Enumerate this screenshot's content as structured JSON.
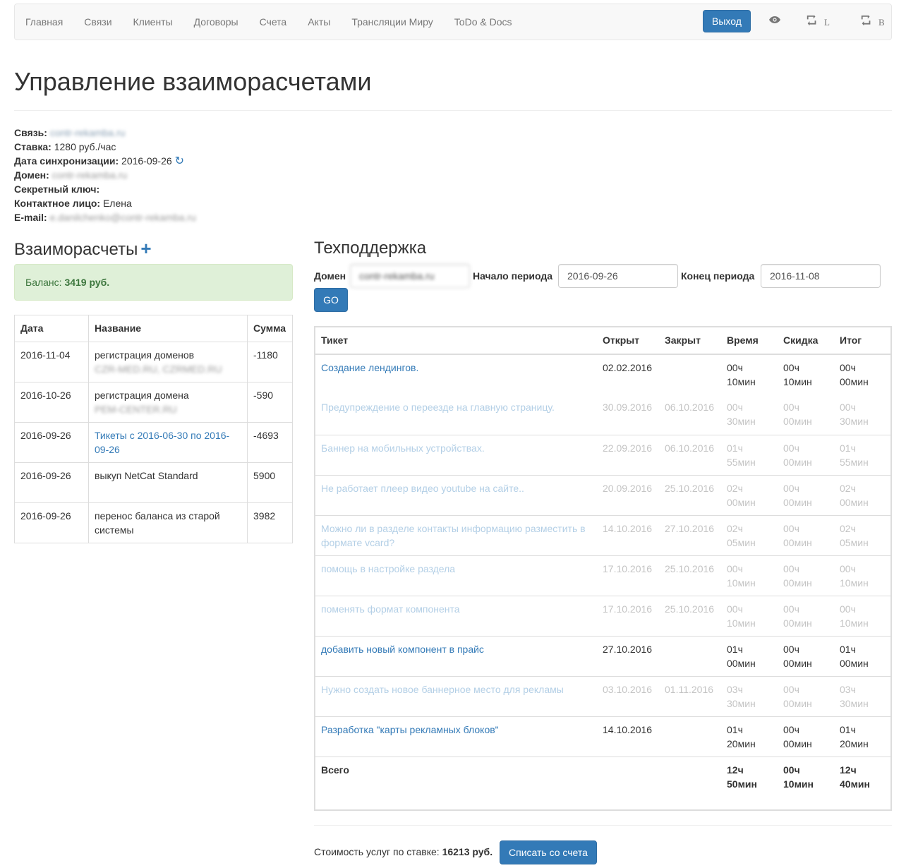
{
  "nav": {
    "items": [
      "Главная",
      "Связи",
      "Клиенты",
      "Договоры",
      "Счета",
      "Акты",
      "Трансляции Миру",
      "ToDo & Docs"
    ],
    "exit_label": "Выход",
    "eye_icon": "eye-icon",
    "retweet_l": "L",
    "retweet_b": "B"
  },
  "page": {
    "title": "Управление взаиморасчетами"
  },
  "info": {
    "link_label": "Связь:",
    "link_value": "contr-rekamba.ru",
    "rate_label": "Ставка:",
    "rate_value": "1280 руб./час",
    "sync_label": "Дата синхронизации:",
    "sync_value": "2016-09-26",
    "domain_label": "Домен:",
    "domain_value": "contr-rekamba.ru",
    "secret_label": "Секретный ключ:",
    "contact_label": "Контактное лицо:",
    "contact_value": "Елена",
    "email_label": "E-mail:",
    "email_value": "e.danilchenko@contr-rekamba.ru"
  },
  "settlements": {
    "title": "Взаиморасчеты",
    "balance_label": "Баланс:",
    "balance_value": "3419 руб.",
    "headers": [
      "Дата",
      "Название",
      "Сумма"
    ],
    "rows": [
      {
        "date": "2016-11-04",
        "name": "регистрация доменов",
        "sub": "CZR-MED.RU, CZRMED.RU",
        "sum": "-1180"
      },
      {
        "date": "2016-10-26",
        "name": "регистрация домена",
        "sub": "PEM-CENTER.RU",
        "sum": "-590"
      },
      {
        "date": "2016-09-26",
        "name": "Тикеты с 2016-06-30 по 2016-09-26",
        "sub": "",
        "sum": "-4693"
      },
      {
        "date": "2016-09-26",
        "name": "выкуп NetCat Standard",
        "sub": "",
        "sum": "5900"
      },
      {
        "date": "2016-09-26",
        "name": "перенос баланса из старой системы",
        "sub": "",
        "sum": "3982"
      }
    ]
  },
  "support": {
    "title": "Техподдержка",
    "domain_label": "Домен",
    "domain_value": "contr-rekamba.ru",
    "start_label": "Начало периода",
    "start_value": "2016-09-26",
    "end_label": "Конец периода",
    "end_value": "2016-11-08",
    "go_label": "GO",
    "headers": [
      "Тикет",
      "Открыт",
      "Закрыт",
      "Время",
      "Скидка",
      "Итог"
    ],
    "rows": [
      {
        "name": "Создание лендингов.",
        "opened": "02.02.2016",
        "closed": "",
        "time": [
          "00ч",
          "10мин"
        ],
        "discount": [
          "00ч",
          "10мин"
        ],
        "total": [
          "00ч",
          "00мин"
        ],
        "muted": false
      },
      {
        "name": "Предупреждение о переезде на главную страницу.",
        "opened": "30.09.2016",
        "closed": "06.10.2016",
        "time": [
          "00ч",
          "30мин"
        ],
        "discount": [
          "00ч",
          "00мин"
        ],
        "total": [
          "00ч",
          "30мин"
        ],
        "muted": true
      },
      {
        "name": "Баннер на мобильных устройствах.",
        "opened": "22.09.2016",
        "closed": "06.10.2016",
        "time": [
          "01ч",
          "55мин"
        ],
        "discount": [
          "00ч",
          "00мин"
        ],
        "total": [
          "01ч",
          "55мин"
        ],
        "muted": true
      },
      {
        "name": "Не работает плеер видео youtube на сайте..",
        "opened": "20.09.2016",
        "closed": "25.10.2016",
        "time": [
          "02ч",
          "00мин"
        ],
        "discount": [
          "00ч",
          "00мин"
        ],
        "total": [
          "02ч",
          "00мин"
        ],
        "muted": true
      },
      {
        "name": "Можно ли в разделе контакты информацию разместить в формате vcard?",
        "opened": "14.10.2016",
        "closed": "27.10.2016",
        "time": [
          "02ч",
          "05мин"
        ],
        "discount": [
          "00ч",
          "00мин"
        ],
        "total": [
          "02ч",
          "05мин"
        ],
        "muted": true
      },
      {
        "name": "помощь в настройке раздела",
        "opened": "17.10.2016",
        "closed": "25.10.2016",
        "time": [
          "00ч",
          "10мин"
        ],
        "discount": [
          "00ч",
          "00мин"
        ],
        "total": [
          "00ч",
          "10мин"
        ],
        "muted": true
      },
      {
        "name": "поменять формат компонента",
        "opened": "17.10.2016",
        "closed": "25.10.2016",
        "time": [
          "00ч",
          "10мин"
        ],
        "discount": [
          "00ч",
          "00мин"
        ],
        "total": [
          "00ч",
          "10мин"
        ],
        "muted": true
      },
      {
        "name": "добавить новый компонент в прайс",
        "opened": "27.10.2016",
        "closed": "",
        "time": [
          "01ч",
          "00мин"
        ],
        "discount": [
          "00ч",
          "00мин"
        ],
        "total": [
          "01ч",
          "00мин"
        ],
        "muted": false
      },
      {
        "name": "Нужно создать новое баннерное место для рекламы",
        "opened": "03.10.2016",
        "closed": "01.11.2016",
        "time": [
          "03ч",
          "30мин"
        ],
        "discount": [
          "00ч",
          "00мин"
        ],
        "total": [
          "03ч",
          "30мин"
        ],
        "muted": true
      },
      {
        "name": "Разработка \"карты рекламных блоков\"",
        "opened": "14.10.2016",
        "closed": "",
        "time": [
          "01ч",
          "20мин"
        ],
        "discount": [
          "00ч",
          "00мин"
        ],
        "total": [
          "01ч",
          "20мин"
        ],
        "muted": false
      }
    ],
    "total_label": "Всего",
    "total_time": [
      "12ч",
      "50мин"
    ],
    "total_discount": [
      "00ч",
      "10мин"
    ],
    "total_total": [
      "12ч",
      "40мин"
    ],
    "cost_label": "Стоимость услуг по ставке:",
    "cost_value": "16213 руб.",
    "charge_label": "Списать со счета"
  },
  "colors": {
    "primary": "#337ab7",
    "muted_link": "#b3cfe6",
    "success_bg": "#dff0d8",
    "success_text": "#3c763d"
  }
}
